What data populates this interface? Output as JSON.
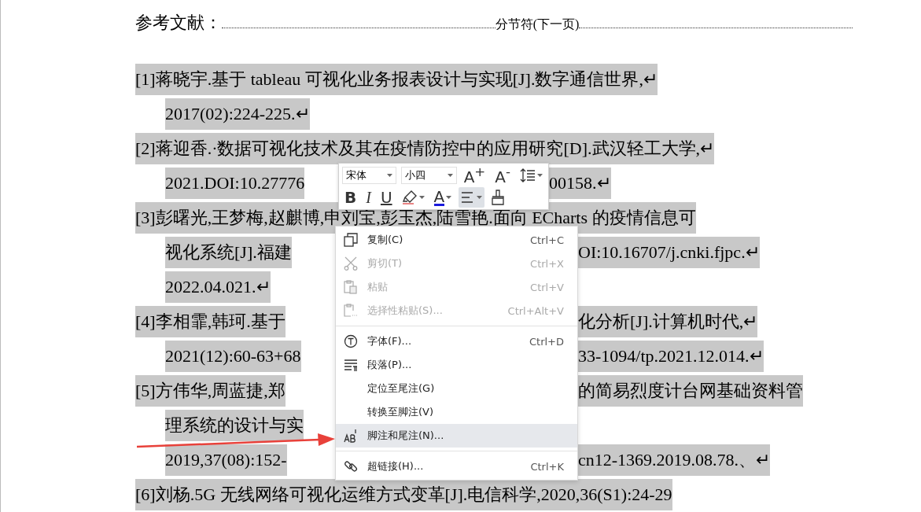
{
  "heading": {
    "title": "参考文献：",
    "section_break": "分节符(下一页)"
  },
  "lines": [
    {
      "kind": "entry",
      "selected": true,
      "text": "[1]蒋晓宇.基于 tableau 可视化业务报表设计与实现[J].数字通信世界,↵"
    },
    {
      "kind": "continuation",
      "selected": true,
      "text": "2017(02):224-225.↵"
    },
    {
      "kind": "entry",
      "selected": true,
      "text": "[2]蒋迎香.·数据可视化技术及其在疫情防控中的应用研究[D].武汉轻工大学,↵"
    },
    {
      "kind": "continuation",
      "selected": true,
      "text": "2021.DOI:10.27776",
      "right": "00158.↵"
    },
    {
      "kind": "entry",
      "selected": true,
      "text": "[3]彭曙光,王梦梅,赵麒博,申刘宝,彭玉杰,陆雪艳.面向 ECharts 的疫情信息可"
    },
    {
      "kind": "continuation",
      "selected": true,
      "text": "视化系统[J].福建",
      "right": "OI:10.16707/j.cnki.fjpc.↵"
    },
    {
      "kind": "continuation",
      "selected": true,
      "text": "2022.04.021.↵"
    },
    {
      "kind": "entry",
      "selected": true,
      "text": "[4]李相霏,韩珂.基于",
      "right": "化分析[J].计算机时代,↵"
    },
    {
      "kind": "continuation",
      "selected": true,
      "text": "2021(12):60-63+68",
      "right": "33-1094/tp.2021.12.014.↵"
    },
    {
      "kind": "entry",
      "selected": true,
      "text": "[5]方伟华,周蓝捷,郑",
      "right": "的简易烈度计台网基础资料管"
    },
    {
      "kind": "continuation",
      "selected": true,
      "text": "理系统的设计与实"
    },
    {
      "kind": "continuation",
      "selected": true,
      "text": "2019,37(08):152-",
      "right": "cn12-1369.2019.08.78.、↵"
    },
    {
      "kind": "entry",
      "selected": true,
      "text": "[6]刘杨.5G 无线网络可视化运维方式变革[J].电信科学,2020,36(S1):24-29"
    }
  ],
  "mini_toolbar": {
    "font": "宋体",
    "size": "小四",
    "row1": [
      {
        "kind": "grow",
        "label": "A$^{+}$",
        "selected": false
      },
      {
        "kind": "shrink",
        "label": "A$^{-}$",
        "selected": false
      },
      {
        "kind": "spacing",
        "selected": false
      }
    ],
    "row2": [
      {
        "kind": "bold",
        "label": "B",
        "selected": false
      },
      {
        "kind": "italic",
        "label": "I",
        "selected": false
      },
      {
        "kind": "underline",
        "label": "U",
        "selected": false
      },
      {
        "kind": "highlight",
        "selected": false
      },
      {
        "kind": "color",
        "label": "A",
        "color": "#1a1adc",
        "selected": false
      },
      {
        "kind": "align",
        "selected": true
      },
      {
        "kind": "painter",
        "selected": false
      }
    ]
  },
  "context_menu": {
    "groups": [
      [
        {
          "kind": "copy",
          "label": "复制(C)",
          "shortcut": "Ctrl+C",
          "disabled": false,
          "selected": false
        },
        {
          "kind": "scissors",
          "label": "剪切(T)",
          "shortcut": "Ctrl+X",
          "disabled": true,
          "selected": false
        },
        {
          "kind": "paste",
          "label": "粘贴",
          "shortcut": "Ctrl+V",
          "disabled": true,
          "selected": false
        },
        {
          "kind": "paste-special",
          "label": "选择性粘贴(S)...",
          "shortcut": "Ctrl+Alt+V",
          "disabled": true,
          "selected": false
        }
      ],
      [
        {
          "kind": "font",
          "label": "字体(F)...",
          "shortcut": "Ctrl+D",
          "disabled": false,
          "selected": false
        },
        {
          "kind": "paragraph",
          "label": "段落(P)...",
          "disabled": false,
          "selected": false
        },
        {
          "kind": "plain",
          "label": "定位至尾注(G)",
          "disabled": false,
          "selected": false
        },
        {
          "kind": "plain",
          "label": "转换至脚注(V)",
          "disabled": false,
          "selected": false
        },
        {
          "kind": "footnote",
          "label": "脚注和尾注(N)...",
          "disabled": false,
          "selected": true
        }
      ],
      [
        {
          "kind": "link",
          "label": "超链接(H)...",
          "shortcut": "Ctrl+K",
          "disabled": false,
          "selected": false
        }
      ]
    ]
  }
}
